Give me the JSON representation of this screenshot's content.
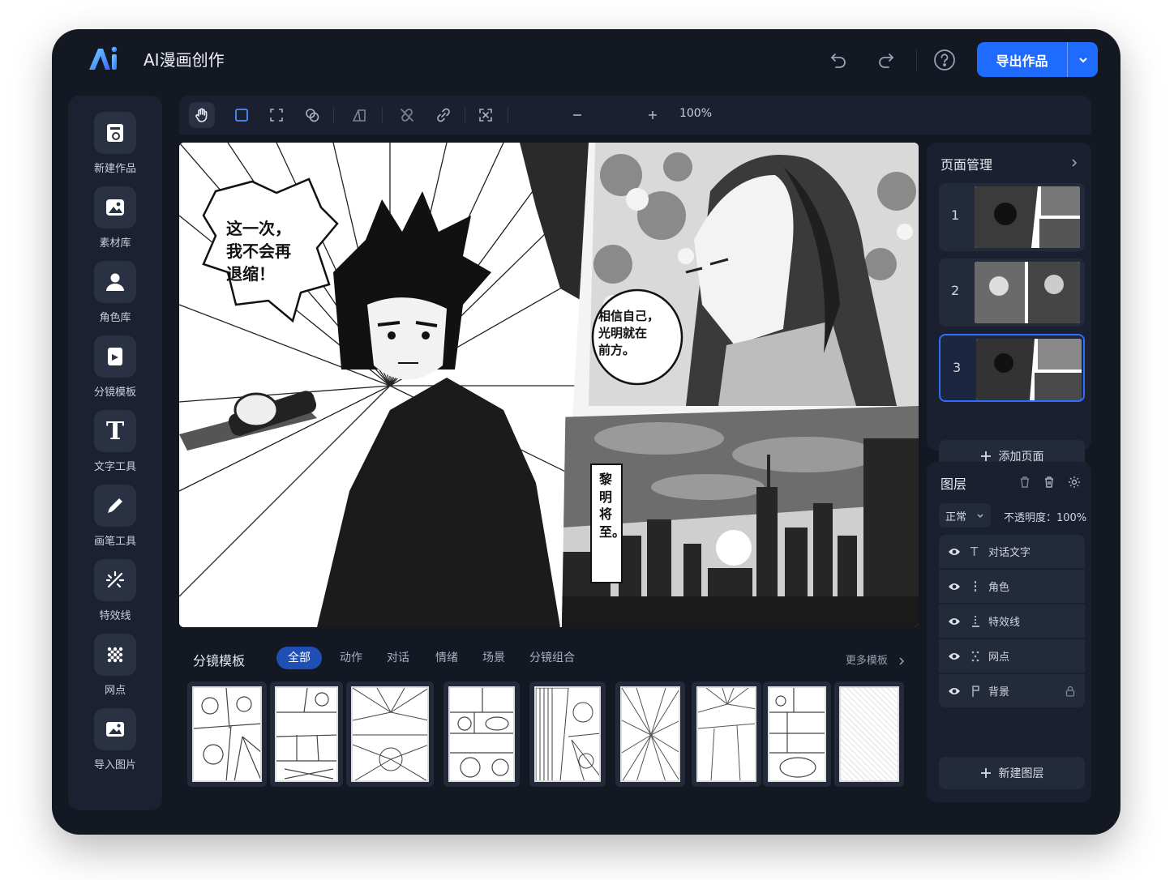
{
  "header": {
    "app_title": "AI漫画创作",
    "export_label": "导出作品"
  },
  "sidebar": {
    "items": [
      {
        "label": "新建作品",
        "icon": "new-work-icon"
      },
      {
        "label": "素材库",
        "icon": "gallery-icon"
      },
      {
        "label": "角色库",
        "icon": "user-icon"
      },
      {
        "label": "分镜模板",
        "icon": "storyboard-icon"
      },
      {
        "label": "文字工具",
        "icon": "text-icon"
      },
      {
        "label": "画笔工具",
        "icon": "pen-icon"
      },
      {
        "label": "特效线",
        "icon": "effect-lines-icon"
      },
      {
        "label": "网点",
        "icon": "screentone-icon"
      },
      {
        "label": "导入图片",
        "icon": "import-image-icon"
      }
    ]
  },
  "toolbar": {
    "zoom": "100%"
  },
  "canvas": {
    "bubble1": [
      "这一次，",
      "我不会再",
      "退缩！"
    ],
    "bubble2": [
      "相信自己，",
      "光明就在",
      "前方。"
    ],
    "bubble3": "黎明将至。"
  },
  "pages": {
    "title": "页面管理",
    "items": [
      "1",
      "2",
      "3"
    ],
    "selected": "3",
    "add_label": "添加页面"
  },
  "layers": {
    "title": "图层",
    "blend_mode": "正常",
    "opacity_label": "不透明度：",
    "opacity": "100%",
    "items": [
      {
        "label": "对话文字",
        "icon": "text-layer-icon"
      },
      {
        "label": "角色",
        "icon": "character-layer-icon"
      },
      {
        "label": "特效线",
        "icon": "effect-layer-icon"
      },
      {
        "label": "网点",
        "icon": "dots-layer-icon"
      },
      {
        "label": "背景",
        "icon": "background-layer-icon",
        "locked": true
      }
    ],
    "new_label": "新建图层"
  },
  "templates": {
    "title": "分镜模板",
    "tabs": [
      "全部",
      "动作",
      "对话",
      "情绪",
      "场景",
      "分镜组合"
    ],
    "active_tab": "全部",
    "more_label": "更多模板"
  },
  "colors": {
    "accent": "#1f6bff",
    "bg": "#131823",
    "panel": "#1a2030"
  }
}
